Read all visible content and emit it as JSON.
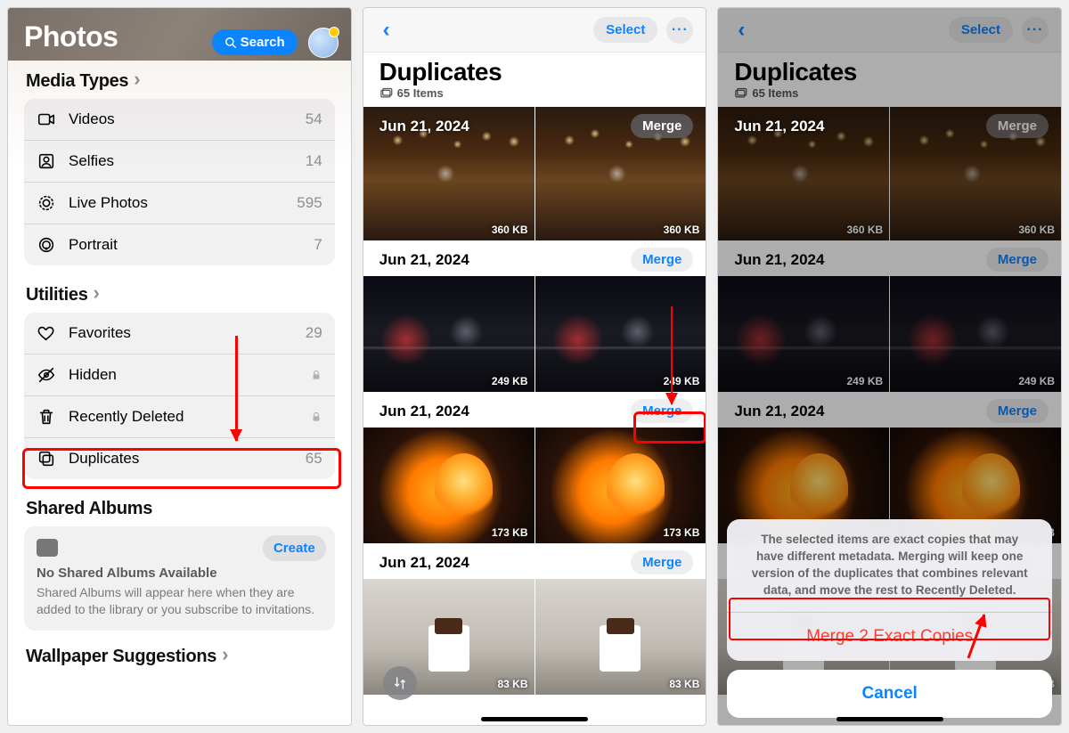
{
  "pane1": {
    "title": "Photos",
    "search": "Search",
    "sections": {
      "media_types": {
        "header": "Media Types",
        "rows": [
          {
            "icon": "video",
            "label": "Videos",
            "count": "54"
          },
          {
            "icon": "selfie",
            "label": "Selfies",
            "count": "14"
          },
          {
            "icon": "livephoto",
            "label": "Live Photos",
            "count": "595"
          },
          {
            "icon": "portrait",
            "label": "Portrait",
            "count": "7"
          }
        ]
      },
      "utilities": {
        "header": "Utilities",
        "rows": [
          {
            "icon": "heart",
            "label": "Favorites",
            "count": "29",
            "lock": false
          },
          {
            "icon": "eye-slash",
            "label": "Hidden",
            "count": "",
            "lock": true
          },
          {
            "icon": "trash",
            "label": "Recently Deleted",
            "count": "",
            "lock": true
          },
          {
            "icon": "duplicate",
            "label": "Duplicates",
            "count": "65",
            "lock": false
          }
        ]
      },
      "shared": {
        "header": "Shared Albums",
        "create": "Create",
        "empty_title": "No Shared Albums Available",
        "empty_desc": "Shared Albums will appear here when they are added to the library or you subscribe to invitations."
      },
      "wallpaper": {
        "header": "Wallpaper Suggestions"
      }
    }
  },
  "dup_common": {
    "title": "Duplicates",
    "items": "65 Items",
    "select": "Select",
    "groups": [
      {
        "date": "Jun 21, 2024",
        "merge": "Merge",
        "style": "restaurant",
        "size": "360 KB",
        "overlay": true
      },
      {
        "date": "Jun 21, 2024",
        "merge": "Merge",
        "style": "night",
        "size": "249 KB",
        "overlay": false
      },
      {
        "date": "Jun 21, 2024",
        "merge": "Merge",
        "style": "cocktail",
        "size": "173 KB",
        "overlay": false
      },
      {
        "date": "Jun 21, 2024",
        "merge": "Merge",
        "style": "coffee",
        "size": "83 KB",
        "overlay": false
      }
    ]
  },
  "sheet": {
    "msg": "The selected items are exact copies that may have different metadata. Merging will keep one version of the duplicates that combines relevant data, and move the rest to Recently Deleted.",
    "action": "Merge 2 Exact Copies",
    "cancel": "Cancel"
  }
}
